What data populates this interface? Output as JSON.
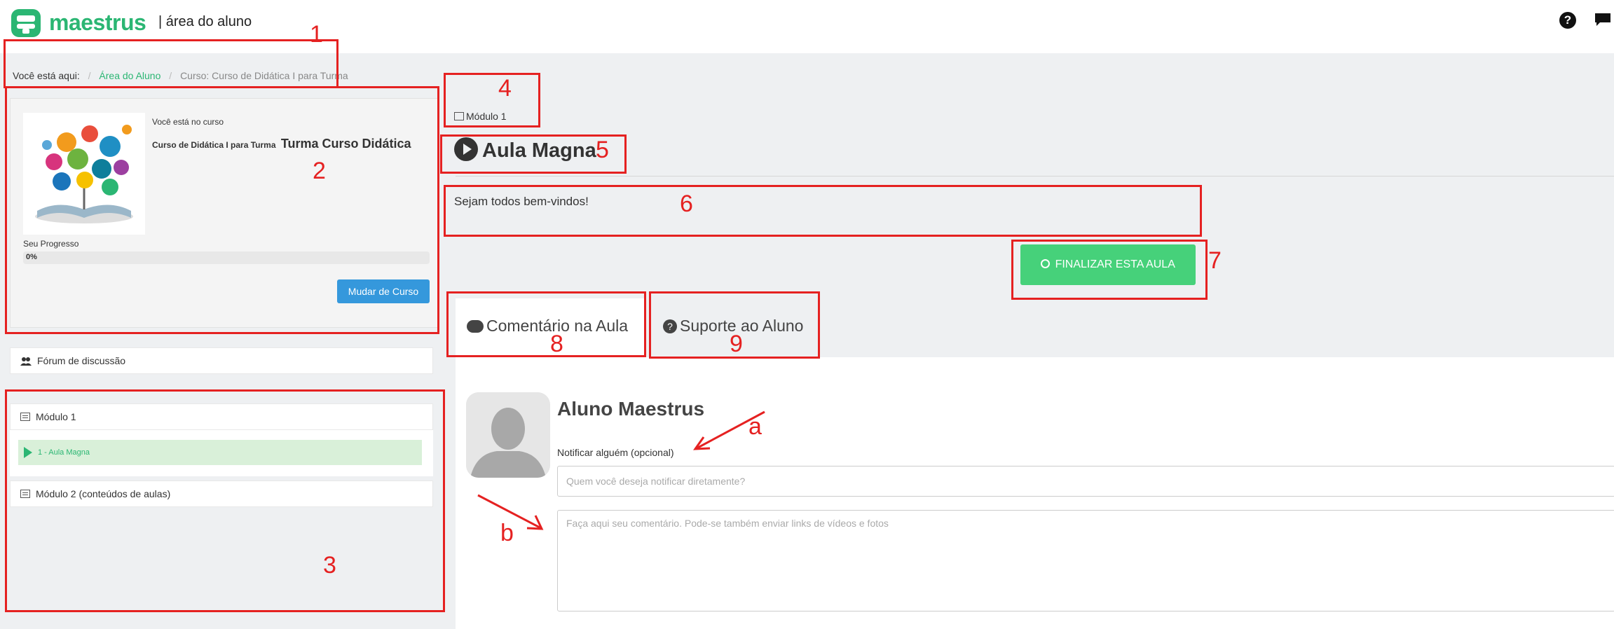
{
  "header": {
    "logo_text": "maestrus",
    "area_title": "| área do aluno",
    "help_icon": "question-circle-icon",
    "chat_icon": "comment-icon"
  },
  "breadcrumb": {
    "prefix": "Você está aqui:",
    "items": [
      "Área do Aluno",
      "Curso: Curso de Didática I para Turma"
    ]
  },
  "course_card": {
    "you_are": "Você está no curso",
    "course_name": "Curso de Didática I para Turma",
    "class_name": "Turma Curso Didática",
    "progress_label": "Seu Progresso",
    "progress_text": "0%",
    "progress_value": 0,
    "change_button": "Mudar de Curso"
  },
  "sidebar": {
    "forum_label": "Fórum de discussão",
    "modules": [
      {
        "label": "Módulo 1",
        "lessons": [
          "1 - Aula Magna"
        ]
      },
      {
        "label": "Módulo 2 (conteúdos de aulas)",
        "lessons": []
      }
    ]
  },
  "main": {
    "module_crumb": "Módulo 1",
    "lesson_title": "Aula Magna",
    "welcome": "Sejam todos bem-vindos!",
    "finish_button": "FINALIZAR ESTA AULA",
    "tabs": [
      "Comentário na Aula",
      "Suporte ao Aluno"
    ]
  },
  "comment_form": {
    "student_name": "Aluno Maestrus",
    "notify_label": "Notificar alguém (opcional)",
    "notify_placeholder": "Quem você deseja notificar diretamente?",
    "comment_placeholder": "Faça aqui seu comentário. Pode-se também enviar links de vídeos e fotos"
  },
  "annotations": {
    "numbers": [
      "1",
      "2",
      "3",
      "4",
      "5",
      "6",
      "7",
      "8",
      "9"
    ],
    "letters": [
      "a",
      "b"
    ],
    "color": "#e52121"
  },
  "colors": {
    "brand_green": "#2bb673",
    "button_blue": "#3598dc",
    "finish_green": "#46d17a"
  }
}
